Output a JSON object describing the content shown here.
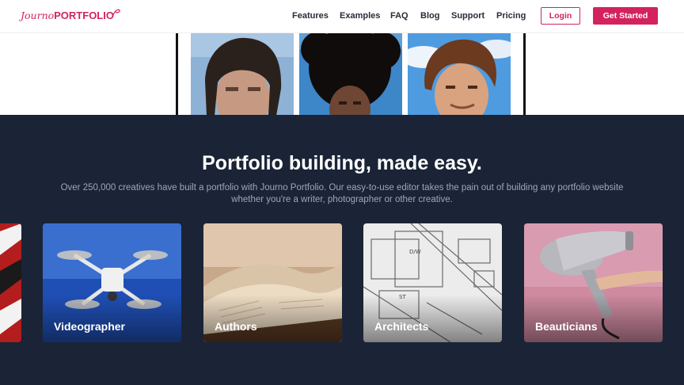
{
  "header": {
    "logo_script": "Journo",
    "logo_bold": "PORTFOLIO",
    "nav": [
      "Features",
      "Examples",
      "FAQ",
      "Blog",
      "Support",
      "Pricing"
    ],
    "login_label": "Login",
    "get_started_label": "Get Started"
  },
  "colors": {
    "brand": "#d4225f",
    "dark_section": "#1b2436",
    "subtext": "#9ea6b6"
  },
  "section": {
    "headline": "Portfolio building, made easy.",
    "subtext": "Over 250,000 creatives have built a portfolio with Journo Portfolio. Our easy-to-use editor takes the pain out of building any portfolio website whether you're a writer, photographer or other creative."
  },
  "cards": [
    {
      "label": "Videographer",
      "image": "drone-photo"
    },
    {
      "label": "Authors",
      "image": "open-book-photo"
    },
    {
      "label": "Architects",
      "image": "floor-plan-photo"
    },
    {
      "label": "Beauticians",
      "image": "hair-dryer-photo"
    }
  ]
}
